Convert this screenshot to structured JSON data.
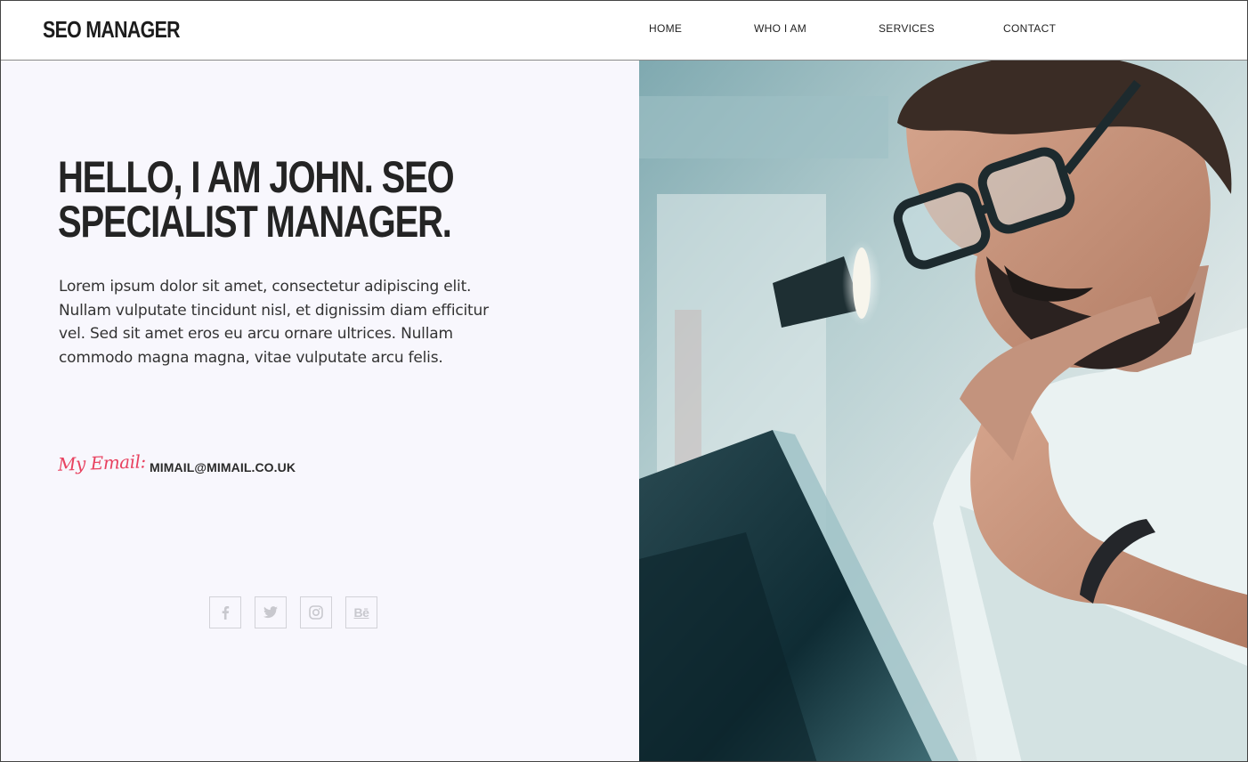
{
  "header": {
    "logo": "SEO MANAGER",
    "nav": [
      "HOME",
      "WHO I AM",
      "SERVICES",
      "CONTACT"
    ]
  },
  "hero": {
    "headline_line1": "HELLO, I AM JOHN. SEO",
    "headline_line2": "SPECIALIST MANAGER.",
    "paragraph": "Lorem ipsum dolor sit amet, consectetur adipiscing elit. Nullam vulputate tincidunt nisl, et dignissim diam efficitur vel. Sed sit amet eros eu arcu ornare ultrices. Nullam commodo magna magna, vitae vulputate arcu felis.",
    "email_label": "My Email:",
    "email_value": "MIMAIL@MIMAIL.CO.UK"
  },
  "socials": [
    {
      "icon": "facebook-icon"
    },
    {
      "icon": "twitter-icon"
    },
    {
      "icon": "instagram-icon"
    },
    {
      "icon": "behance-icon",
      "glyph": "Bē"
    }
  ],
  "photo": {
    "subject": "bearded-man-with-glasses-using-laptop"
  },
  "colors": {
    "accent": "#e8415f",
    "panel_bg": "#f8f7fd",
    "text_dark": "#242424"
  }
}
